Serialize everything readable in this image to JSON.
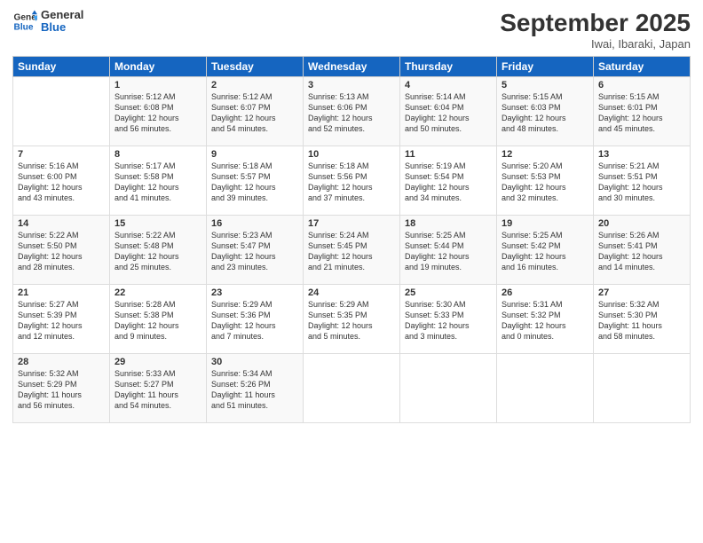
{
  "header": {
    "logo_line1": "General",
    "logo_line2": "Blue",
    "month": "September 2025",
    "location": "Iwai, Ibaraki, Japan"
  },
  "weekdays": [
    "Sunday",
    "Monday",
    "Tuesday",
    "Wednesday",
    "Thursday",
    "Friday",
    "Saturday"
  ],
  "weeks": [
    [
      {
        "day": "",
        "info": ""
      },
      {
        "day": "1",
        "info": "Sunrise: 5:12 AM\nSunset: 6:08 PM\nDaylight: 12 hours\nand 56 minutes."
      },
      {
        "day": "2",
        "info": "Sunrise: 5:12 AM\nSunset: 6:07 PM\nDaylight: 12 hours\nand 54 minutes."
      },
      {
        "day": "3",
        "info": "Sunrise: 5:13 AM\nSunset: 6:06 PM\nDaylight: 12 hours\nand 52 minutes."
      },
      {
        "day": "4",
        "info": "Sunrise: 5:14 AM\nSunset: 6:04 PM\nDaylight: 12 hours\nand 50 minutes."
      },
      {
        "day": "5",
        "info": "Sunrise: 5:15 AM\nSunset: 6:03 PM\nDaylight: 12 hours\nand 48 minutes."
      },
      {
        "day": "6",
        "info": "Sunrise: 5:15 AM\nSunset: 6:01 PM\nDaylight: 12 hours\nand 45 minutes."
      }
    ],
    [
      {
        "day": "7",
        "info": "Sunrise: 5:16 AM\nSunset: 6:00 PM\nDaylight: 12 hours\nand 43 minutes."
      },
      {
        "day": "8",
        "info": "Sunrise: 5:17 AM\nSunset: 5:58 PM\nDaylight: 12 hours\nand 41 minutes."
      },
      {
        "day": "9",
        "info": "Sunrise: 5:18 AM\nSunset: 5:57 PM\nDaylight: 12 hours\nand 39 minutes."
      },
      {
        "day": "10",
        "info": "Sunrise: 5:18 AM\nSunset: 5:56 PM\nDaylight: 12 hours\nand 37 minutes."
      },
      {
        "day": "11",
        "info": "Sunrise: 5:19 AM\nSunset: 5:54 PM\nDaylight: 12 hours\nand 34 minutes."
      },
      {
        "day": "12",
        "info": "Sunrise: 5:20 AM\nSunset: 5:53 PM\nDaylight: 12 hours\nand 32 minutes."
      },
      {
        "day": "13",
        "info": "Sunrise: 5:21 AM\nSunset: 5:51 PM\nDaylight: 12 hours\nand 30 minutes."
      }
    ],
    [
      {
        "day": "14",
        "info": "Sunrise: 5:22 AM\nSunset: 5:50 PM\nDaylight: 12 hours\nand 28 minutes."
      },
      {
        "day": "15",
        "info": "Sunrise: 5:22 AM\nSunset: 5:48 PM\nDaylight: 12 hours\nand 25 minutes."
      },
      {
        "day": "16",
        "info": "Sunrise: 5:23 AM\nSunset: 5:47 PM\nDaylight: 12 hours\nand 23 minutes."
      },
      {
        "day": "17",
        "info": "Sunrise: 5:24 AM\nSunset: 5:45 PM\nDaylight: 12 hours\nand 21 minutes."
      },
      {
        "day": "18",
        "info": "Sunrise: 5:25 AM\nSunset: 5:44 PM\nDaylight: 12 hours\nand 19 minutes."
      },
      {
        "day": "19",
        "info": "Sunrise: 5:25 AM\nSunset: 5:42 PM\nDaylight: 12 hours\nand 16 minutes."
      },
      {
        "day": "20",
        "info": "Sunrise: 5:26 AM\nSunset: 5:41 PM\nDaylight: 12 hours\nand 14 minutes."
      }
    ],
    [
      {
        "day": "21",
        "info": "Sunrise: 5:27 AM\nSunset: 5:39 PM\nDaylight: 12 hours\nand 12 minutes."
      },
      {
        "day": "22",
        "info": "Sunrise: 5:28 AM\nSunset: 5:38 PM\nDaylight: 12 hours\nand 9 minutes."
      },
      {
        "day": "23",
        "info": "Sunrise: 5:29 AM\nSunset: 5:36 PM\nDaylight: 12 hours\nand 7 minutes."
      },
      {
        "day": "24",
        "info": "Sunrise: 5:29 AM\nSunset: 5:35 PM\nDaylight: 12 hours\nand 5 minutes."
      },
      {
        "day": "25",
        "info": "Sunrise: 5:30 AM\nSunset: 5:33 PM\nDaylight: 12 hours\nand 3 minutes."
      },
      {
        "day": "26",
        "info": "Sunrise: 5:31 AM\nSunset: 5:32 PM\nDaylight: 12 hours\nand 0 minutes."
      },
      {
        "day": "27",
        "info": "Sunrise: 5:32 AM\nSunset: 5:30 PM\nDaylight: 11 hours\nand 58 minutes."
      }
    ],
    [
      {
        "day": "28",
        "info": "Sunrise: 5:32 AM\nSunset: 5:29 PM\nDaylight: 11 hours\nand 56 minutes."
      },
      {
        "day": "29",
        "info": "Sunrise: 5:33 AM\nSunset: 5:27 PM\nDaylight: 11 hours\nand 54 minutes."
      },
      {
        "day": "30",
        "info": "Sunrise: 5:34 AM\nSunset: 5:26 PM\nDaylight: 11 hours\nand 51 minutes."
      },
      {
        "day": "",
        "info": ""
      },
      {
        "day": "",
        "info": ""
      },
      {
        "day": "",
        "info": ""
      },
      {
        "day": "",
        "info": ""
      }
    ]
  ]
}
